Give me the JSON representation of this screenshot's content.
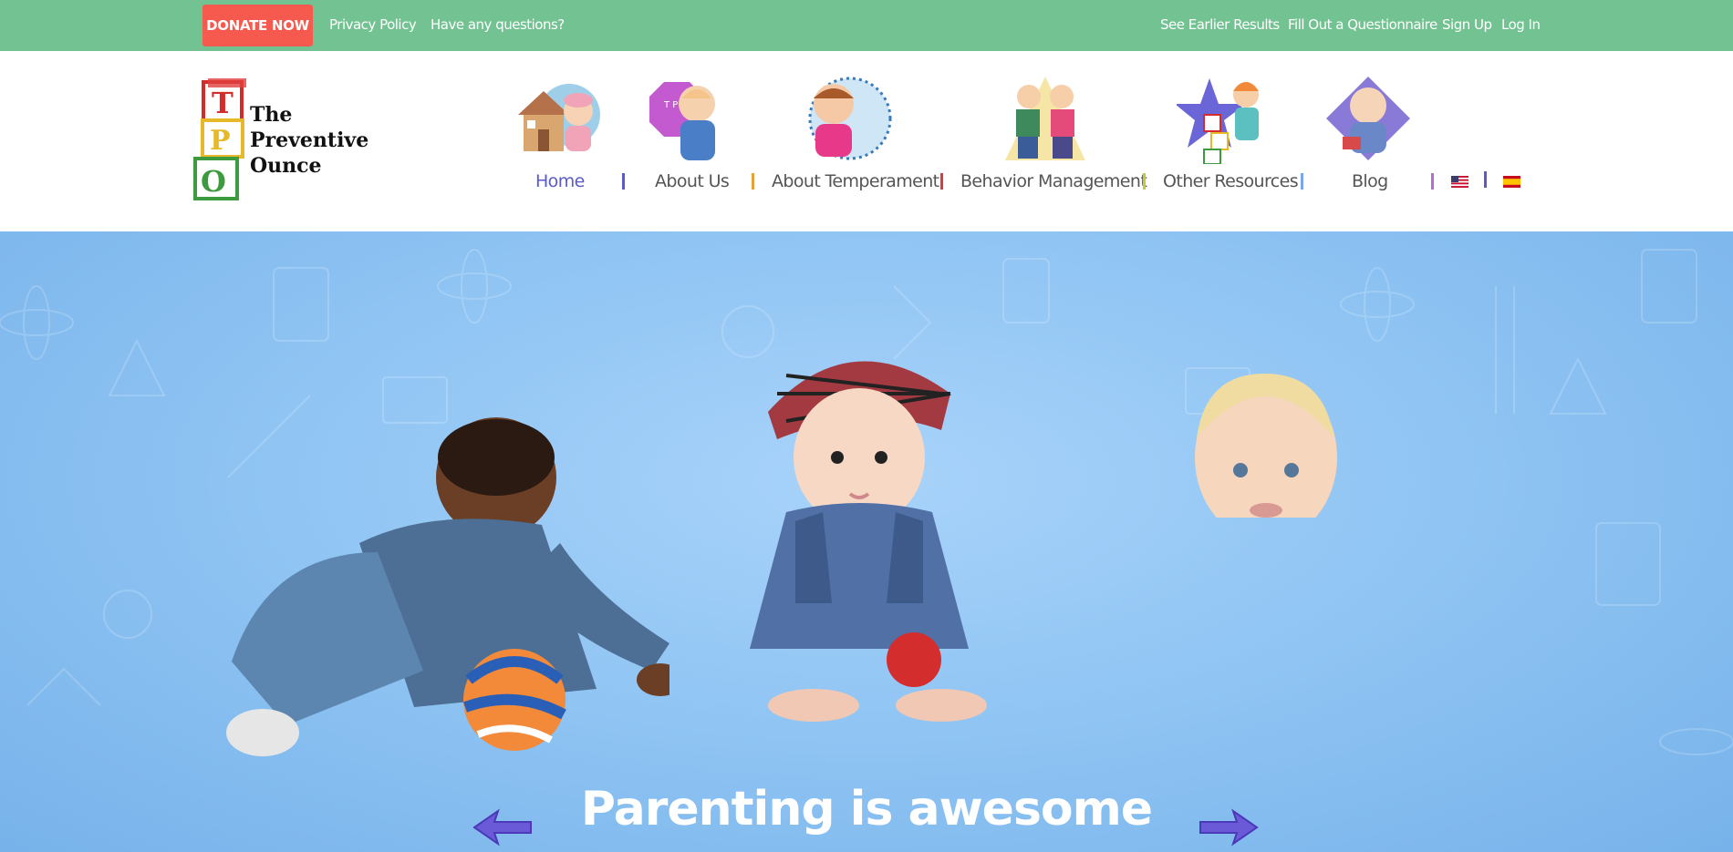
{
  "topbar": {
    "donate_label": "DONATE NOW",
    "left_links": [
      "Privacy Policy",
      "Have any questions?"
    ],
    "right_links": [
      "See Earlier Results",
      "Fill Out a Questionnaire",
      "Sign Up",
      "Log In"
    ]
  },
  "logo": {
    "letters": [
      "T",
      "P",
      "O"
    ],
    "lines": [
      "The",
      "Preventive",
      "Ounce"
    ]
  },
  "nav": {
    "items": [
      {
        "label": "Home",
        "icon": "house-baby-icon",
        "active": true
      },
      {
        "label": "About Us",
        "icon": "baby-octagon-icon",
        "active": false
      },
      {
        "label": "About Temperament",
        "icon": "crying-child-icon",
        "active": false
      },
      {
        "label": "Behavior Management",
        "icon": "fighting-kids-icon",
        "active": false
      },
      {
        "label": "Other Resources",
        "icon": "girl-blocks-star-icon",
        "active": false
      },
      {
        "label": "Blog",
        "icon": "baby-reading-icon",
        "active": false
      }
    ],
    "separator_colors": [
      "#5a5ac8",
      "#e6a23a",
      "#e0383b",
      "#c5c83a",
      "#7aa8e6",
      "#b070d0",
      "#5a5ac8"
    ],
    "languages": [
      "english-flag-icon",
      "spanish-flag-icon"
    ]
  },
  "hero": {
    "headline": "Parenting is awesome",
    "prev_icon": "arrow-left-icon",
    "next_icon": "arrow-right-icon"
  },
  "colors": {
    "topbar": "#72c292",
    "donate": "#f65a4f",
    "nav_active": "#5a5ac8",
    "hero": "#8cc2f2"
  }
}
